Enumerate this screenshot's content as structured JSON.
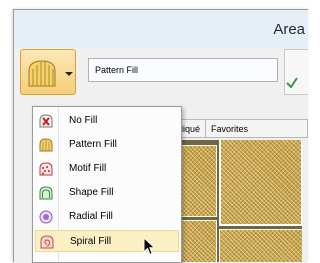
{
  "window": {
    "title": "Area"
  },
  "toolbar": {
    "fill_button_icon": "pattern-fill-icon",
    "fill_field_value": "Pattern Fill"
  },
  "tabs": [
    "s",
    "Appliqué",
    "Favorites"
  ],
  "fill_menu": {
    "items": [
      {
        "label": "No Fill",
        "icon": "no-fill-icon",
        "selected": false
      },
      {
        "label": "Pattern Fill",
        "icon": "pattern-fill-icon",
        "selected": false
      },
      {
        "label": "Motif Fill",
        "icon": "motif-fill-icon",
        "selected": false
      },
      {
        "label": "Shape Fill",
        "icon": "shape-fill-icon",
        "selected": false
      },
      {
        "label": "Radial Fill",
        "icon": "radial-fill-icon",
        "selected": false
      },
      {
        "label": "Spiral Fill",
        "icon": "spiral-fill-icon",
        "selected": true
      }
    ]
  },
  "colors": {
    "accent": "#f5cf78",
    "selection": "#fbefc4",
    "pattern": "#c9a64e"
  }
}
